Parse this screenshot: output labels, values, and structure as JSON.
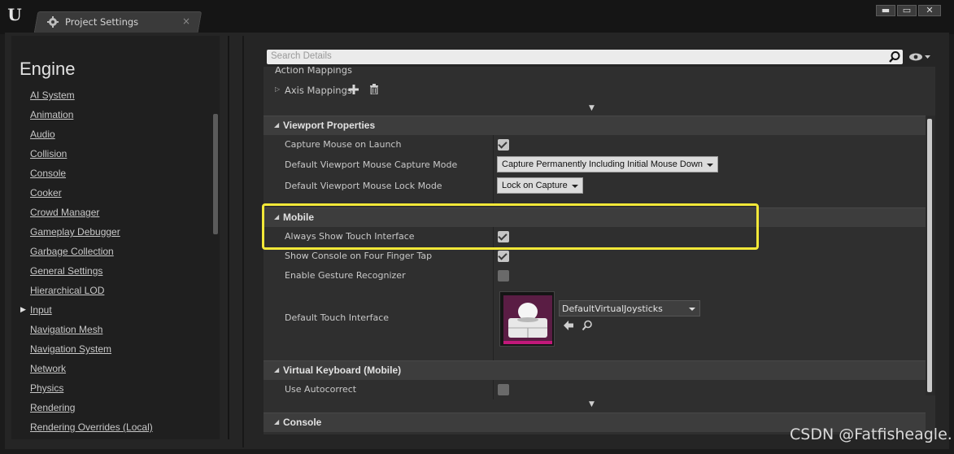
{
  "window": {
    "logo": "U",
    "tab_label": "Project Settings",
    "tab_close": "×",
    "buttons": {
      "minimize": "▬",
      "maximize": "▭",
      "close": "✕"
    }
  },
  "sidebar": {
    "heading": "Engine",
    "items": [
      "AI System",
      "Animation",
      "Audio",
      "Collision",
      "Console",
      "Cooker",
      "Crowd Manager",
      "Gameplay Debugger",
      "Garbage Collection",
      "General Settings",
      "Hierarchical LOD",
      "Input",
      "Navigation Mesh",
      "Navigation System",
      "Network",
      "Physics",
      "Rendering",
      "Rendering Overrides (Local)"
    ],
    "expanded_item": "Input"
  },
  "search": {
    "placeholder": "Search Details"
  },
  "details": {
    "cut_row": "Action Mappings",
    "axis_mappings": "Axis Mappings",
    "viewport": {
      "title": "Viewport Properties",
      "capture_mouse": {
        "label": "Capture Mouse on Launch",
        "checked": true
      },
      "capture_mode": {
        "label": "Default Viewport Mouse Capture Mode",
        "value": "Capture Permanently Including Initial Mouse Down"
      },
      "lock_mode": {
        "label": "Default Viewport Mouse Lock Mode",
        "value": "Lock on Capture"
      }
    },
    "mobile": {
      "title": "Mobile",
      "always_show_touch": {
        "label": "Always Show Touch Interface",
        "checked": true
      },
      "show_console": {
        "label": "Show Console on Four Finger Tap",
        "checked": true
      },
      "gesture": {
        "label": "Enable Gesture Recognizer",
        "checked": false
      },
      "touch_interface": {
        "label": "Default Touch Interface",
        "value": "DefaultVirtualJoysticks"
      }
    },
    "virtual_keyboard": {
      "title": "Virtual Keyboard (Mobile)",
      "autocorrect": {
        "label": "Use Autocorrect",
        "checked": false
      }
    },
    "console": {
      "title": "Console"
    }
  },
  "highlight_color": "#f2e838",
  "watermark": "CSDN @Fatfisheagle."
}
